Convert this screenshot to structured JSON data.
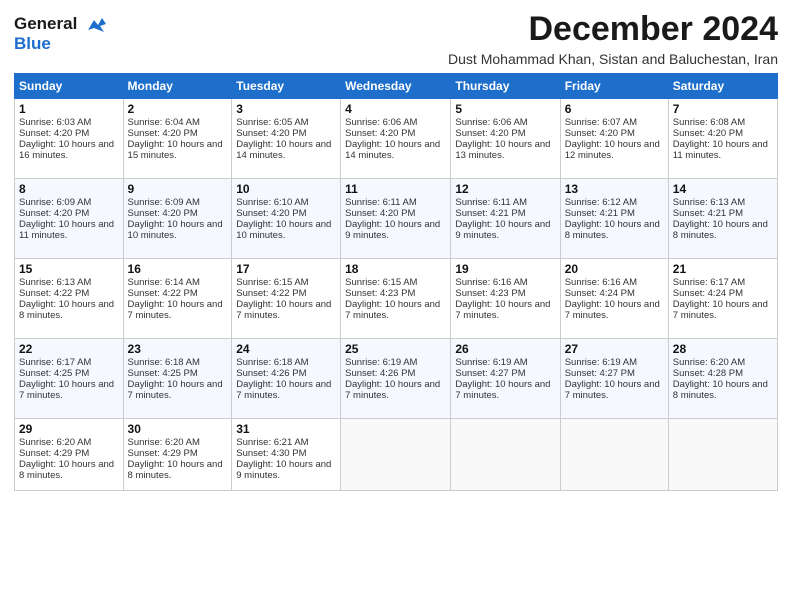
{
  "logo": {
    "line1": "General",
    "line2": "Blue"
  },
  "title": "December 2024",
  "subtitle": "Dust Mohammad Khan, Sistan and Baluchestan, Iran",
  "days_of_week": [
    "Sunday",
    "Monday",
    "Tuesday",
    "Wednesday",
    "Thursday",
    "Friday",
    "Saturday"
  ],
  "weeks": [
    [
      {
        "day": "1",
        "sunrise": "6:03 AM",
        "sunset": "4:20 PM",
        "daylight": "10 hours and 16 minutes."
      },
      {
        "day": "2",
        "sunrise": "6:04 AM",
        "sunset": "4:20 PM",
        "daylight": "10 hours and 15 minutes."
      },
      {
        "day": "3",
        "sunrise": "6:05 AM",
        "sunset": "4:20 PM",
        "daylight": "10 hours and 14 minutes."
      },
      {
        "day": "4",
        "sunrise": "6:06 AM",
        "sunset": "4:20 PM",
        "daylight": "10 hours and 14 minutes."
      },
      {
        "day": "5",
        "sunrise": "6:06 AM",
        "sunset": "4:20 PM",
        "daylight": "10 hours and 13 minutes."
      },
      {
        "day": "6",
        "sunrise": "6:07 AM",
        "sunset": "4:20 PM",
        "daylight": "10 hours and 12 minutes."
      },
      {
        "day": "7",
        "sunrise": "6:08 AM",
        "sunset": "4:20 PM",
        "daylight": "10 hours and 11 minutes."
      }
    ],
    [
      {
        "day": "8",
        "sunrise": "6:09 AM",
        "sunset": "4:20 PM",
        "daylight": "10 hours and 11 minutes."
      },
      {
        "day": "9",
        "sunrise": "6:09 AM",
        "sunset": "4:20 PM",
        "daylight": "10 hours and 10 minutes."
      },
      {
        "day": "10",
        "sunrise": "6:10 AM",
        "sunset": "4:20 PM",
        "daylight": "10 hours and 10 minutes."
      },
      {
        "day": "11",
        "sunrise": "6:11 AM",
        "sunset": "4:20 PM",
        "daylight": "10 hours and 9 minutes."
      },
      {
        "day": "12",
        "sunrise": "6:11 AM",
        "sunset": "4:21 PM",
        "daylight": "10 hours and 9 minutes."
      },
      {
        "day": "13",
        "sunrise": "6:12 AM",
        "sunset": "4:21 PM",
        "daylight": "10 hours and 8 minutes."
      },
      {
        "day": "14",
        "sunrise": "6:13 AM",
        "sunset": "4:21 PM",
        "daylight": "10 hours and 8 minutes."
      }
    ],
    [
      {
        "day": "15",
        "sunrise": "6:13 AM",
        "sunset": "4:22 PM",
        "daylight": "10 hours and 8 minutes."
      },
      {
        "day": "16",
        "sunrise": "6:14 AM",
        "sunset": "4:22 PM",
        "daylight": "10 hours and 7 minutes."
      },
      {
        "day": "17",
        "sunrise": "6:15 AM",
        "sunset": "4:22 PM",
        "daylight": "10 hours and 7 minutes."
      },
      {
        "day": "18",
        "sunrise": "6:15 AM",
        "sunset": "4:23 PM",
        "daylight": "10 hours and 7 minutes."
      },
      {
        "day": "19",
        "sunrise": "6:16 AM",
        "sunset": "4:23 PM",
        "daylight": "10 hours and 7 minutes."
      },
      {
        "day": "20",
        "sunrise": "6:16 AM",
        "sunset": "4:24 PM",
        "daylight": "10 hours and 7 minutes."
      },
      {
        "day": "21",
        "sunrise": "6:17 AM",
        "sunset": "4:24 PM",
        "daylight": "10 hours and 7 minutes."
      }
    ],
    [
      {
        "day": "22",
        "sunrise": "6:17 AM",
        "sunset": "4:25 PM",
        "daylight": "10 hours and 7 minutes."
      },
      {
        "day": "23",
        "sunrise": "6:18 AM",
        "sunset": "4:25 PM",
        "daylight": "10 hours and 7 minutes."
      },
      {
        "day": "24",
        "sunrise": "6:18 AM",
        "sunset": "4:26 PM",
        "daylight": "10 hours and 7 minutes."
      },
      {
        "day": "25",
        "sunrise": "6:19 AM",
        "sunset": "4:26 PM",
        "daylight": "10 hours and 7 minutes."
      },
      {
        "day": "26",
        "sunrise": "6:19 AM",
        "sunset": "4:27 PM",
        "daylight": "10 hours and 7 minutes."
      },
      {
        "day": "27",
        "sunrise": "6:19 AM",
        "sunset": "4:27 PM",
        "daylight": "10 hours and 7 minutes."
      },
      {
        "day": "28",
        "sunrise": "6:20 AM",
        "sunset": "4:28 PM",
        "daylight": "10 hours and 8 minutes."
      }
    ],
    [
      {
        "day": "29",
        "sunrise": "6:20 AM",
        "sunset": "4:29 PM",
        "daylight": "10 hours and 8 minutes."
      },
      {
        "day": "30",
        "sunrise": "6:20 AM",
        "sunset": "4:29 PM",
        "daylight": "10 hours and 8 minutes."
      },
      {
        "day": "31",
        "sunrise": "6:21 AM",
        "sunset": "4:30 PM",
        "daylight": "10 hours and 9 minutes."
      },
      null,
      null,
      null,
      null
    ]
  ]
}
